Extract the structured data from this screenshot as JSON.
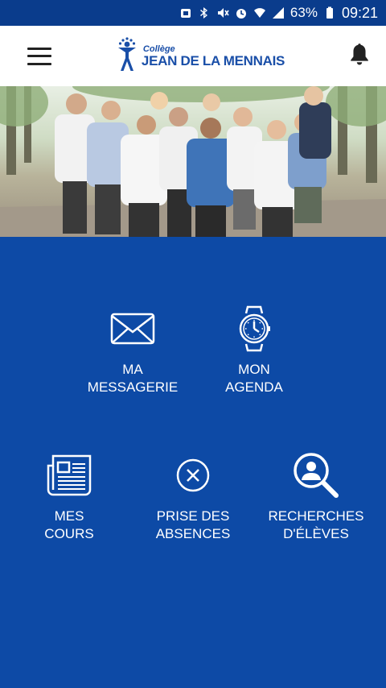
{
  "status_bar": {
    "battery": "63%",
    "time": "09:21"
  },
  "header": {
    "logo_small": "Collège",
    "logo_big": "JEAN DE LA MENNAIS"
  },
  "tiles": {
    "messagerie": {
      "line1": "MA",
      "line2": "MESSAGERIE",
      "icon": "envelope-icon"
    },
    "agenda": {
      "line1": "MON",
      "line2": "AGENDA",
      "icon": "watch-icon"
    },
    "cours": {
      "line1": "MES",
      "line2": "COURS",
      "icon": "newspaper-icon"
    },
    "absences": {
      "line1": "PRISE DES",
      "line2": "ABSENCES",
      "icon": "close-circle-icon"
    },
    "recherches": {
      "line1": "RECHERCHES",
      "line2": "D'ÉLÈVES",
      "icon": "person-search-icon"
    }
  },
  "colors": {
    "primary": "#0d4aa6",
    "status_bar": "#0a3c8c",
    "logo": "#1a4fa8"
  }
}
